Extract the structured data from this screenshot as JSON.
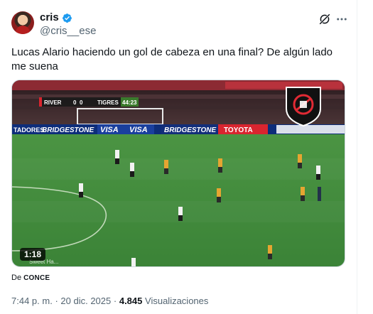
{
  "author": {
    "display_name": "cris",
    "handle": "@cris__ese",
    "avatar": "avatar-image",
    "verified_icon": "verified-badge-icon"
  },
  "actions": {
    "grok_icon": "grok-icon",
    "more_icon": "more-horizontal-icon"
  },
  "tweet": {
    "text": "Lucas Alario haciendo un gol de cabeza en una final? De algún lado me suena"
  },
  "video": {
    "duration": "1:18",
    "scoreboard": {
      "home": "RIVER",
      "home_score": "0",
      "away_score": "0",
      "away": "TIGRES",
      "clock": "44:23"
    },
    "ads": [
      "TADORES",
      "BRIDGESTONE",
      "VISA",
      "VISA",
      "BRIDGESTONE",
      "TOYOTA"
    ],
    "watermark": "Sweet Ha...",
    "colors": {
      "pitch": "#3f8c3a",
      "brand_blue": "#1d9bf0"
    }
  },
  "source": {
    "prefix": "De",
    "name": "CONCE"
  },
  "meta": {
    "time": "7:44 p. m.",
    "separator1": "·",
    "date": "20 dic. 2025",
    "separator2": "·",
    "views_count": "4.845",
    "views_label": "Visualizaciones"
  }
}
